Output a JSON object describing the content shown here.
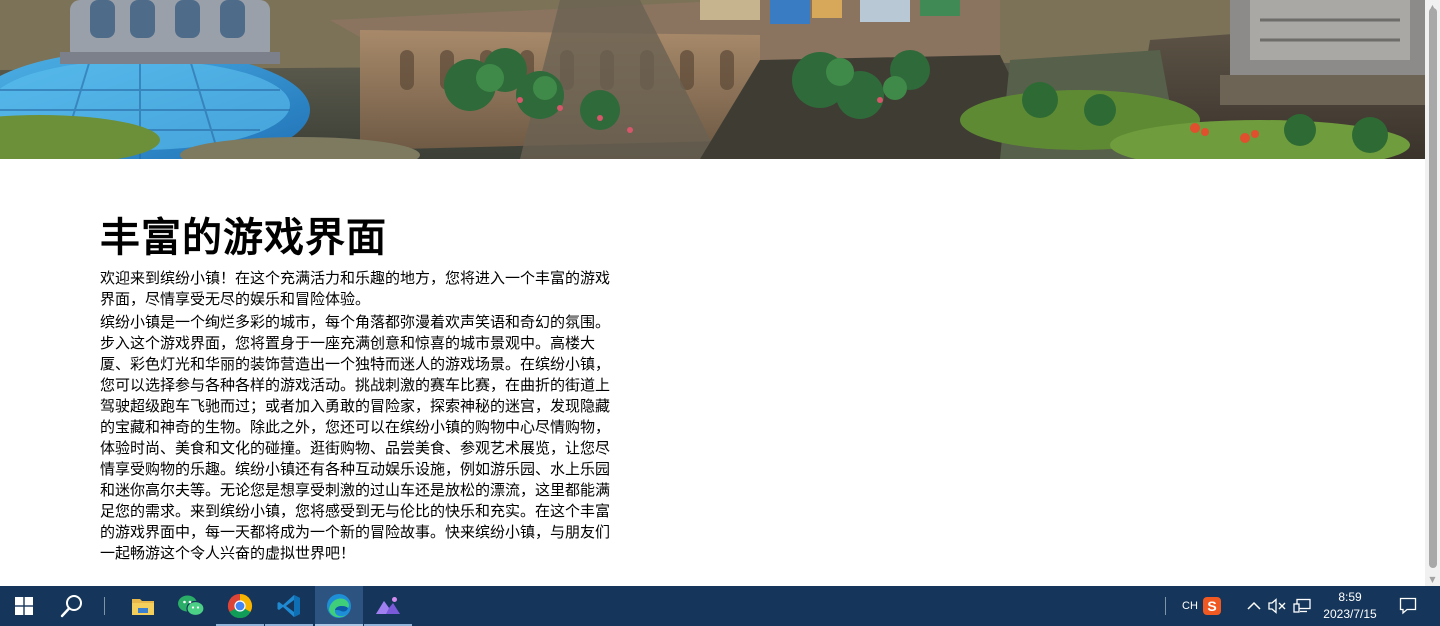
{
  "page": {
    "title": "丰富的游戏界面",
    "paragraph_1": "欢迎来到缤纷小镇！在这个充满活力和乐趣的地方，您将进入一个丰富的游戏界面，尽情享受无尽的娱乐和冒险体验。",
    "paragraph_2": "缤纷小镇是一个绚烂多彩的城市，每个角落都弥漫着欢声笑语和奇幻的氛围。步入这个游戏界面，您将置身于一座充满创意和惊喜的城市景观中。高楼大厦、彩色灯光和华丽的装饰营造出一个独特而迷人的游戏场景。在缤纷小镇，您可以选择参与各种各样的游戏活动。挑战刺激的赛车比赛，在曲折的街道上驾驶超级跑车飞驰而过；或者加入勇敢的冒险家，探索神秘的迷宫，发现隐藏的宝藏和神奇的生物。除此之外，您还可以在缤纷小镇的购物中心尽情购物，体验时尚、美食和文化的碰撞。逛街购物、品尝美食、参观艺术展览，让您尽情享受购物的乐趣。缤纷小镇还有各种互动娱乐设施，例如游乐园、水上乐园和迷你高尔夫等。无论您是想享受刺激的过山车还是放松的漂流，这里都能满足您的需求。来到缤纷小镇，您将感受到无与伦比的快乐和充实。在这个丰富的游戏界面中，每一天都将成为一个新的冒险故事。快来缤纷小镇，与朋友们一起畅游这个令人兴奋的虚拟世界吧！"
  },
  "taskbar": {
    "apps": [
      {
        "name": "File Explorer",
        "icon": "folder-icon"
      },
      {
        "name": "WeChat",
        "icon": "wechat-icon"
      },
      {
        "name": "Google Chrome",
        "icon": "chrome-icon"
      },
      {
        "name": "Visual Studio Code",
        "icon": "vscode-icon"
      },
      {
        "name": "Microsoft Edge",
        "icon": "edge-icon"
      },
      {
        "name": "Image Viewer",
        "icon": "photos-icon"
      }
    ],
    "tray": {
      "input_lang": "CH",
      "ime_icon": "sogou-ime-icon"
    },
    "clock": {
      "time": "8:59",
      "date": "2023/7/15"
    }
  },
  "colors": {
    "taskbar_bg": "#15365a",
    "page_bg": "#ffffff",
    "text": "#000000"
  }
}
